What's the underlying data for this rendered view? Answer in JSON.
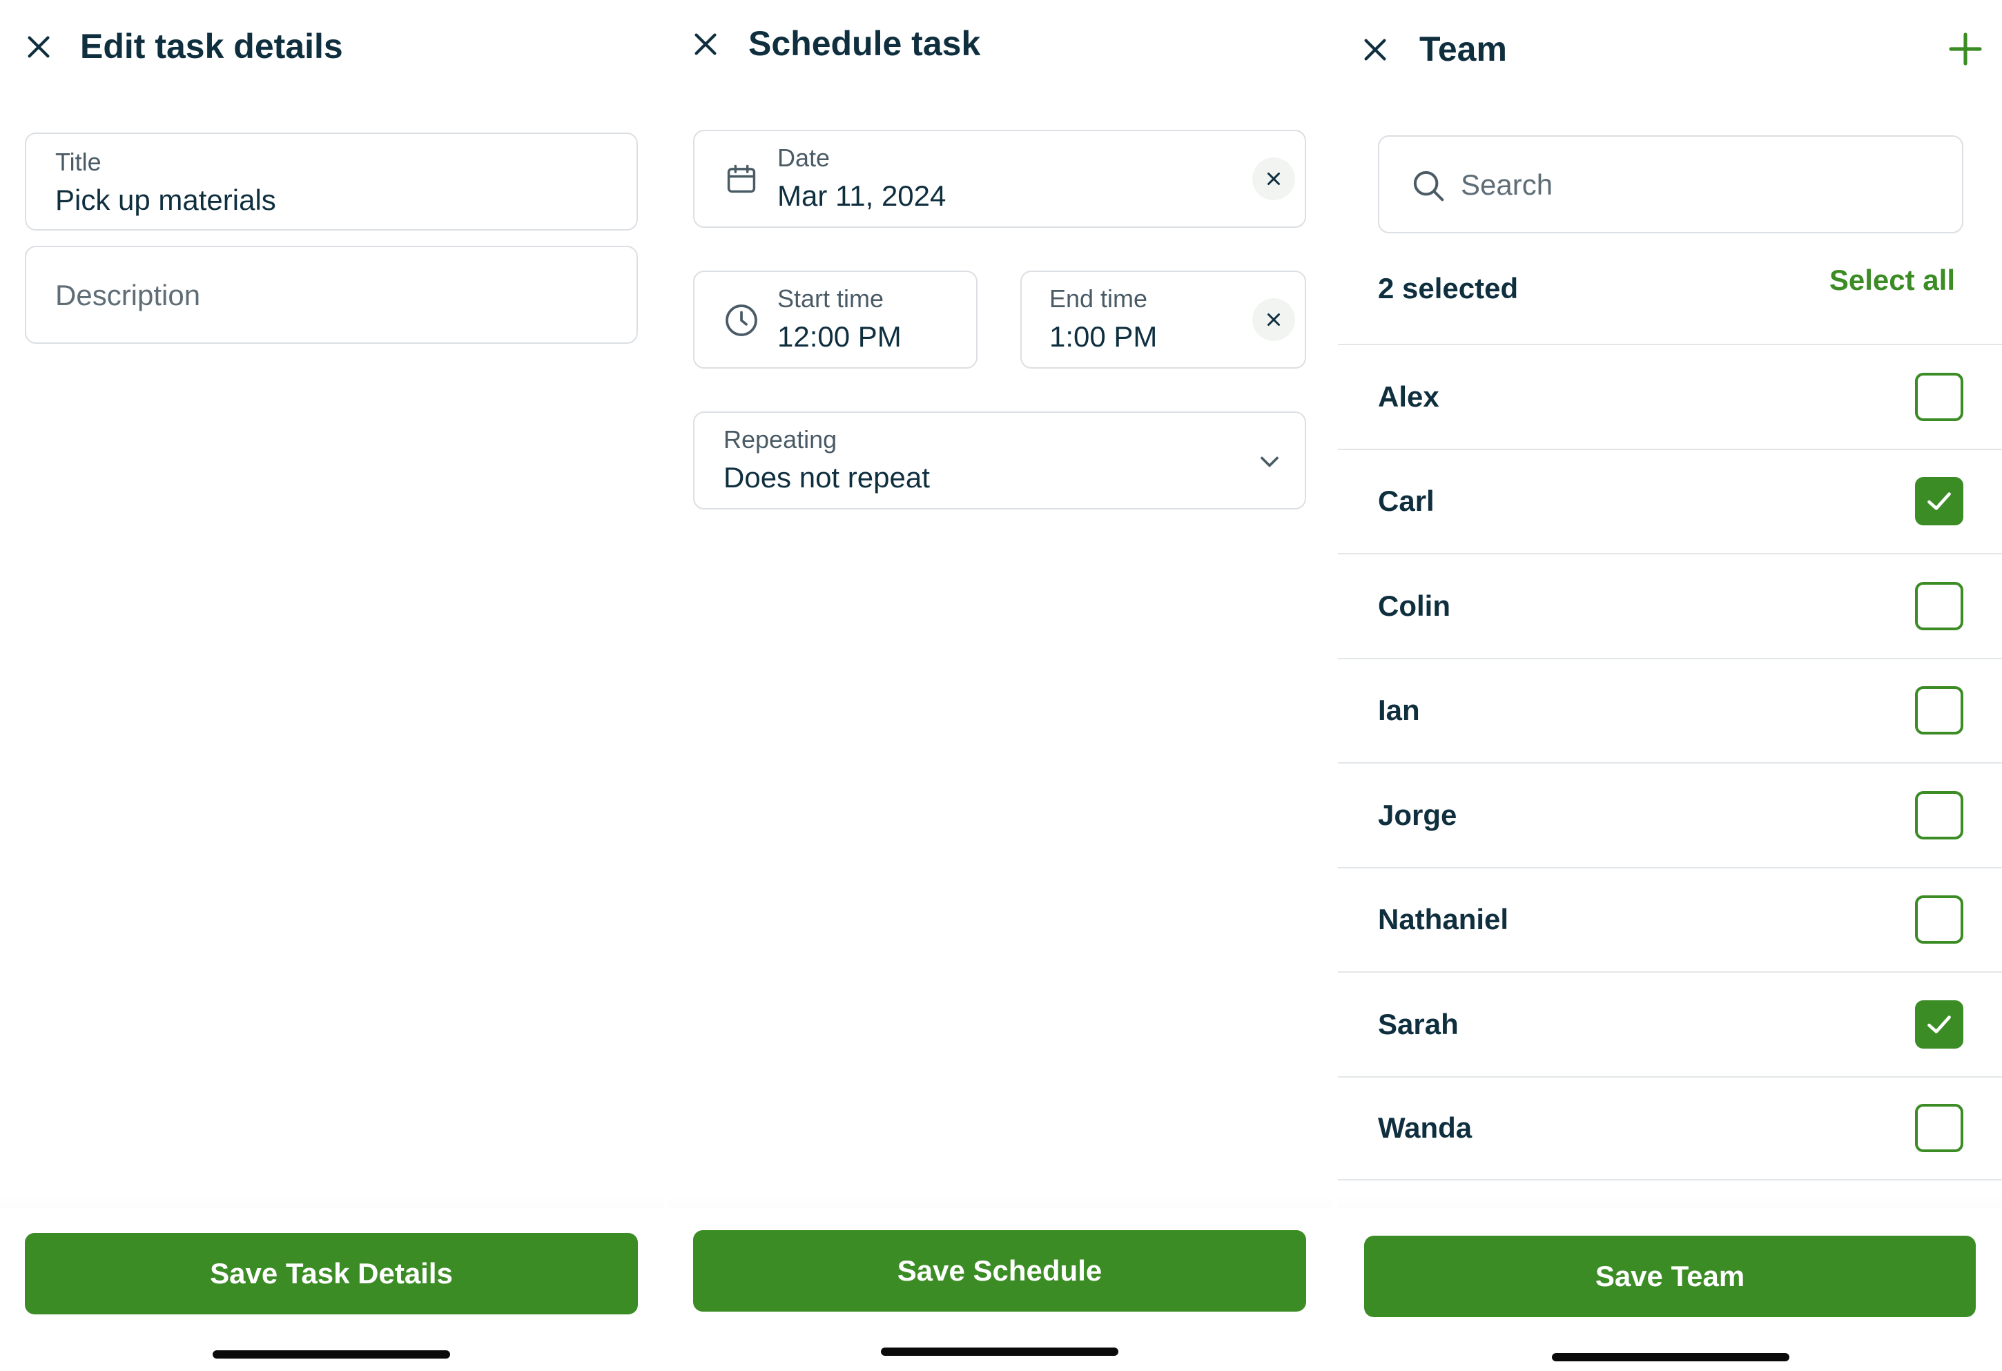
{
  "colors": {
    "accent": "#3c8c26",
    "text_primary": "#0f2f3f",
    "text_secondary": "#4a5b66",
    "border": "#dcdfe3"
  },
  "edit_task": {
    "title": "Edit task details",
    "close_icon": "close-icon",
    "title_field": {
      "label": "Title",
      "value": "Pick up materials"
    },
    "description_field": {
      "placeholder": "Description"
    },
    "save_label": "Save Task Details"
  },
  "schedule_task": {
    "title": "Schedule task",
    "close_icon": "close-icon",
    "date_field": {
      "label": "Date",
      "value": "Mar 11, 2024",
      "icon": "calendar-icon"
    },
    "start_time_field": {
      "label": "Start time",
      "value": "12:00 PM",
      "icon": "clock-icon"
    },
    "end_time_field": {
      "label": "End time",
      "value": "1:00 PM"
    },
    "repeating_field": {
      "label": "Repeating",
      "value": "Does not repeat",
      "icon": "chevron-down-icon"
    },
    "save_label": "Save Schedule"
  },
  "team": {
    "title": "Team",
    "close_icon": "close-icon",
    "add_icon": "plus-icon",
    "search": {
      "placeholder": "Search",
      "value": ""
    },
    "selected_count": "2 selected",
    "select_all_label": "Select all",
    "members": [
      {
        "name": "Alex",
        "checked": false
      },
      {
        "name": "Carl",
        "checked": true
      },
      {
        "name": "Colin",
        "checked": false
      },
      {
        "name": "Ian",
        "checked": false
      },
      {
        "name": "Jorge",
        "checked": false
      },
      {
        "name": "Nathaniel",
        "checked": false
      },
      {
        "name": "Sarah",
        "checked": true
      },
      {
        "name": "Wanda",
        "checked": false
      }
    ],
    "save_label": "Save Team"
  }
}
